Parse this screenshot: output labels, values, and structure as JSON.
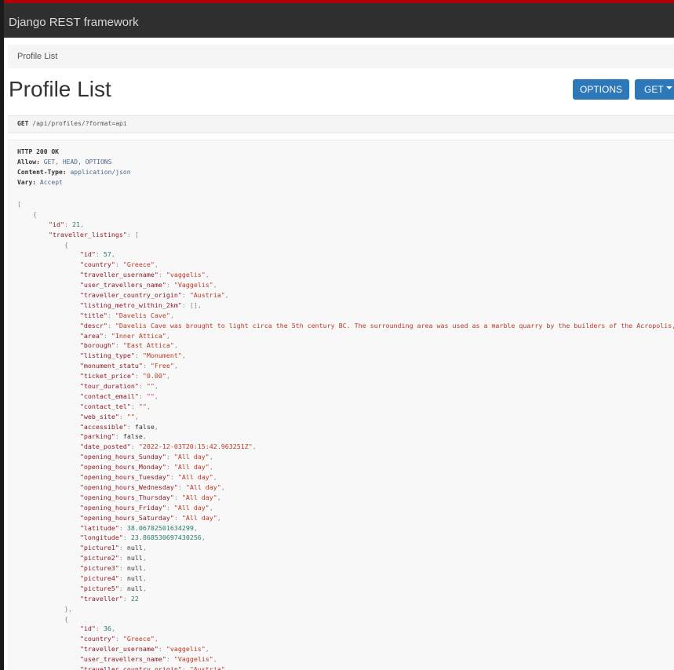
{
  "navbar": {
    "brand": "Django REST framework"
  },
  "breadcrumb": {
    "items": [
      "Profile List"
    ]
  },
  "page": {
    "title": "Profile List"
  },
  "buttons": {
    "options": "OPTIONS",
    "get": "GET"
  },
  "request": {
    "method": "GET",
    "path": "/api/profiles/?format=api"
  },
  "response": {
    "status": "HTTP 200 OK",
    "headers": [
      {
        "name": "Allow:",
        "value": "GET, HEAD, OPTIONS"
      },
      {
        "name": "Content-Type:",
        "value": "application/json"
      },
      {
        "name": "Vary:",
        "value": "Accept"
      }
    ],
    "body_lines": [
      {
        "indent": 0,
        "p": "["
      },
      {
        "indent": 1,
        "p": "{"
      },
      {
        "indent": 2,
        "k": "\"id\"",
        "n": "21",
        "p2": ","
      },
      {
        "indent": 2,
        "k": "\"traveller_listings\"",
        "p": "["
      },
      {
        "indent": 3,
        "p": "{"
      },
      {
        "indent": 4,
        "k": "\"id\"",
        "n": "57",
        "p2": ","
      },
      {
        "indent": 4,
        "k": "\"country\"",
        "s": "\"Greece\"",
        "p2": ","
      },
      {
        "indent": 4,
        "k": "\"traveller_username\"",
        "s": "\"vaggelis\"",
        "p2": ","
      },
      {
        "indent": 4,
        "k": "\"user_travellers_name\"",
        "s": "\"Vaggelis\"",
        "p2": ","
      },
      {
        "indent": 4,
        "k": "\"traveller_country_origin\"",
        "s": "\"Austria\"",
        "p2": ","
      },
      {
        "indent": 4,
        "k": "\"listing_metro_within_2km\"",
        "p": "[]",
        "p2": ","
      },
      {
        "indent": 4,
        "k": "\"title\"",
        "s": "\"Davelis Cave\"",
        "p2": ","
      },
      {
        "indent": 4,
        "k": "\"descr\"",
        "s": "\"Davelis Cave was brought to light circa the 5th century BC. The surrounding area was used as a marble quarry by the builders of the Acropolis, a",
        "p2": ""
      },
      {
        "indent": 4,
        "k": "\"area\"",
        "s": "\"Inner Attica\"",
        "p2": ","
      },
      {
        "indent": 4,
        "k": "\"borough\"",
        "s": "\"East Attica\"",
        "p2": ","
      },
      {
        "indent": 4,
        "k": "\"listing_type\"",
        "s": "\"Monument\"",
        "p2": ","
      },
      {
        "indent": 4,
        "k": "\"monument_statu\"",
        "s": "\"Free\"",
        "p2": ","
      },
      {
        "indent": 4,
        "k": "\"ticket_price\"",
        "s": "\"0.00\"",
        "p2": ","
      },
      {
        "indent": 4,
        "k": "\"tour_duration\"",
        "s": "\"\"",
        "p2": ","
      },
      {
        "indent": 4,
        "k": "\"contact_email\"",
        "s": "\"\"",
        "p2": ","
      },
      {
        "indent": 4,
        "k": "\"contact_tel\"",
        "s": "\"\"",
        "p2": ","
      },
      {
        "indent": 4,
        "k": "\"web_site\"",
        "s": "\"\"",
        "p2": ","
      },
      {
        "indent": 4,
        "k": "\"accessible\"",
        "l": "false",
        "p2": ","
      },
      {
        "indent": 4,
        "k": "\"parking\"",
        "l": "false",
        "p2": ","
      },
      {
        "indent": 4,
        "k": "\"date_posted\"",
        "s": "\"2022-12-03T20:15:42.963251Z\"",
        "p2": ","
      },
      {
        "indent": 4,
        "k": "\"opening_hours_Sunday\"",
        "s": "\"All day\"",
        "p2": ","
      },
      {
        "indent": 4,
        "k": "\"opening_hours_Monday\"",
        "s": "\"All day\"",
        "p2": ","
      },
      {
        "indent": 4,
        "k": "\"opening_hours_Tuesday\"",
        "s": "\"All day\"",
        "p2": ","
      },
      {
        "indent": 4,
        "k": "\"opening_hours_Wednesday\"",
        "s": "\"All day\"",
        "p2": ","
      },
      {
        "indent": 4,
        "k": "\"opening_hours_Thursday\"",
        "s": "\"All day\"",
        "p2": ","
      },
      {
        "indent": 4,
        "k": "\"opening_hours_Friday\"",
        "s": "\"All day\"",
        "p2": ","
      },
      {
        "indent": 4,
        "k": "\"opening_hours_Saturday\"",
        "s": "\"All day\"",
        "p2": ","
      },
      {
        "indent": 4,
        "k": "\"latitude\"",
        "n": "38.06782501634299",
        "p2": ","
      },
      {
        "indent": 4,
        "k": "\"longitude\"",
        "n": "23.868530697430256",
        "p2": ","
      },
      {
        "indent": 4,
        "k": "\"picture1\"",
        "l": "null",
        "p2": ","
      },
      {
        "indent": 4,
        "k": "\"picture2\"",
        "l": "null",
        "p2": ","
      },
      {
        "indent": 4,
        "k": "\"picture3\"",
        "l": "null",
        "p2": ","
      },
      {
        "indent": 4,
        "k": "\"picture4\"",
        "l": "null",
        "p2": ","
      },
      {
        "indent": 4,
        "k": "\"picture5\"",
        "l": "null",
        "p2": ","
      },
      {
        "indent": 4,
        "k": "\"traveller\"",
        "n": "22",
        "p2": ""
      },
      {
        "indent": 3,
        "p": "},"
      },
      {
        "indent": 3,
        "p": "{"
      },
      {
        "indent": 4,
        "k": "\"id\"",
        "n": "36",
        "p2": ","
      },
      {
        "indent": 4,
        "k": "\"country\"",
        "s": "\"Greece\"",
        "p2": ","
      },
      {
        "indent": 4,
        "k": "\"traveller_username\"",
        "s": "\"vaggelis\"",
        "p2": ","
      },
      {
        "indent": 4,
        "k": "\"user_travellers_name\"",
        "s": "\"Vaggelis\"",
        "p2": ","
      },
      {
        "indent": 4,
        "k": "\"traveller_country_origin\"",
        "s": "\"Austria\"",
        "p2": ","
      }
    ]
  },
  "colors": {
    "navbar_bg": "#2f2f2f",
    "navbar_accent": "#b40000",
    "button_primary": "#2c78b8",
    "json_key": "#8b1d24",
    "json_string": "#b83a26",
    "json_number": "#2a7a6a"
  }
}
